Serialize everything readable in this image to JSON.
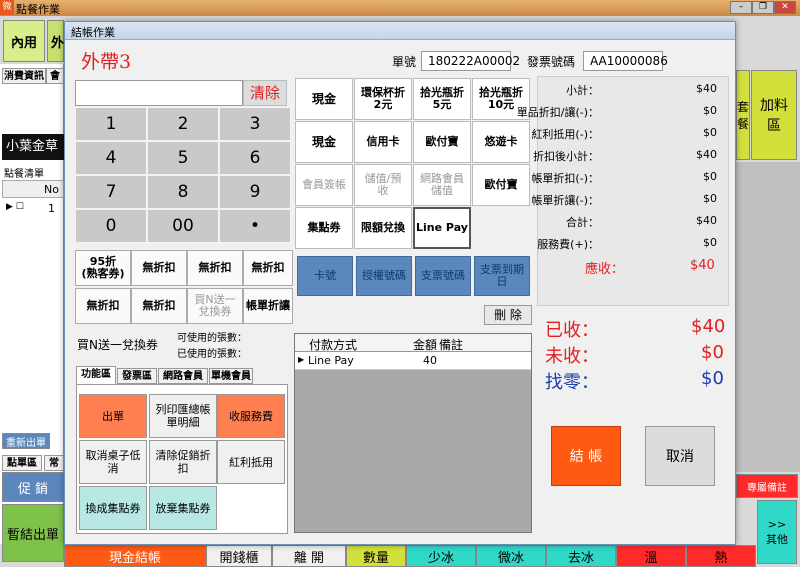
{
  "app": {
    "title": "點餐作業",
    "logo": "微"
  },
  "background": {
    "left_tabs": [
      "內用",
      "外"
    ],
    "sub_tabs": [
      "消費資訊",
      "會"
    ],
    "item_label": "小葉金草",
    "order_list": {
      "title": "點餐清單",
      "col_no": "No",
      "row_no": "1"
    },
    "reprint": "重新出單",
    "tabs2": [
      "點單區",
      "常"
    ],
    "promo": "促 銷",
    "save_order": "暫結出單",
    "right_btns": [
      "套\n餐",
      "加料\n區"
    ],
    "special_note": "專屬備註",
    "other": ">>\n其他",
    "bottom": [
      "現金結帳",
      "開錢櫃",
      "離 開",
      "數量",
      "少冰",
      "微冰",
      "去冰",
      "溫",
      "熱"
    ]
  },
  "dialog": {
    "title": "結帳作業",
    "order_type": "外帶3",
    "order_no_label": "單號",
    "order_no": "180222A00002",
    "invoice_label": "發票號碼",
    "invoice_no": "AA10000086",
    "clear": "清除",
    "keys": [
      "1",
      "2",
      "3",
      "4",
      "5",
      "6",
      "7",
      "8",
      "9",
      "0",
      "00",
      "•"
    ],
    "discount_buttons": [
      "95折\n(熟客券)",
      "無折扣",
      "無折扣",
      "無折扣",
      "無折扣",
      "無折扣",
      "買N送一\n兌換券",
      "帳單折讓"
    ],
    "coupon_title": "買N送一兌換券",
    "coupon_avail": "可使用的張數：",
    "coupon_used": "已使用的張數：",
    "func_tabs": [
      "功能區",
      "發票區",
      "網路會員",
      "單機會員"
    ],
    "func_buttons": [
      "出單",
      "列印匯總帳\n單明細",
      "收服務費",
      "取消桌子低\n消",
      "清除促銷折\n扣",
      "紅利抵用",
      "換成集點券",
      "放棄集點券"
    ],
    "pay_buttons": [
      "現金",
      "環保杯折\n2元",
      "拾光瓶折\n5元",
      "拾光瓶折\n10元",
      "現金",
      "信用卡",
      "歐付寶",
      "悠遊卡",
      "會員簽帳",
      "儲值/預\n收",
      "網路會員\n儲值",
      "歐付寶",
      "集點券",
      "限額兌換",
      "Line Pay"
    ],
    "blue_buttons": [
      "卡號",
      "授權號碼",
      "支票號碼",
      "支票到期\n日"
    ],
    "delete": "刪 除",
    "pay_table": {
      "headers": [
        "付款方式",
        "金額",
        "備註"
      ],
      "rows": [
        [
          "Line Pay",
          "40",
          ""
        ]
      ]
    },
    "summary": [
      {
        "label": "小計：",
        "value": "$40"
      },
      {
        "label": "單品折扣/讓(-)：",
        "value": "$0"
      },
      {
        "label": "紅利抵用(-)：",
        "value": "$0"
      },
      {
        "label": "折扣後小計：",
        "value": "$40"
      },
      {
        "label": "帳單折扣(-)：",
        "value": "$0"
      },
      {
        "label": "帳單折讓(-)：",
        "value": "$0"
      },
      {
        "label": "合計：",
        "value": "$40"
      },
      {
        "label": "服務費(+)：",
        "value": "$0"
      }
    ],
    "due_label": "應收：",
    "due": "$40",
    "received_label": "已收：",
    "received": "$40",
    "unpaid_label": "未收：",
    "unpaid": "$0",
    "change_label": "找零：",
    "change": "$0",
    "checkout": "結 帳",
    "cancel": "取消"
  },
  "colors": {
    "red": "#e02020",
    "orange_btn": "#ff7f50",
    "checkout_bg": "#ff5a14",
    "teal_btn": "#b8e8e4"
  }
}
